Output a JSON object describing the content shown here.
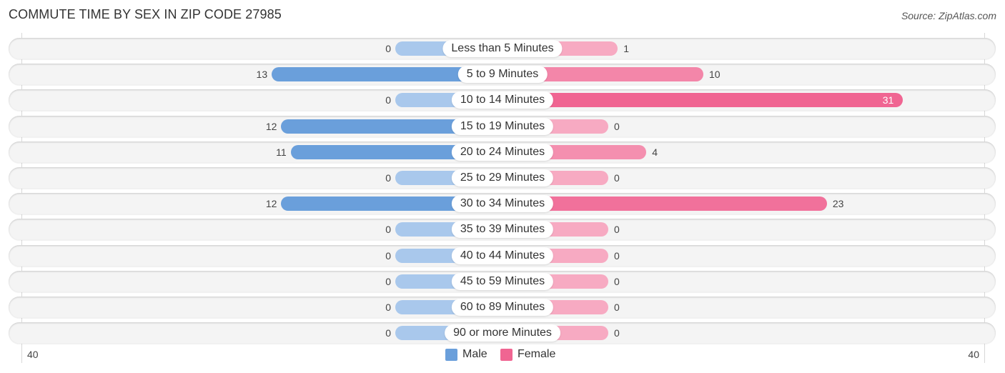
{
  "header": {
    "title": "COMMUTE TIME BY SEX IN ZIP CODE 27985",
    "source": "Source: ZipAtlas.com"
  },
  "colors": {
    "male": "#6a9fdb",
    "male_light": "#a9c8ec",
    "female": "#f06592",
    "female_light": "#f7aac2",
    "row_bg": "#f4f4f4"
  },
  "chart_data": {
    "type": "bar",
    "orientation": "horizontal-diverging",
    "title": "COMMUTE TIME BY SEX IN ZIP CODE 27985",
    "categories": [
      "Less than 5 Minutes",
      "5 to 9 Minutes",
      "10 to 14 Minutes",
      "15 to 19 Minutes",
      "20 to 24 Minutes",
      "25 to 29 Minutes",
      "30 to 34 Minutes",
      "35 to 39 Minutes",
      "40 to 44 Minutes",
      "45 to 59 Minutes",
      "60 to 89 Minutes",
      "90 or more Minutes"
    ],
    "series": [
      {
        "name": "Male",
        "values": [
          0,
          13,
          0,
          12,
          11,
          0,
          12,
          0,
          0,
          0,
          0,
          0
        ]
      },
      {
        "name": "Female",
        "values": [
          1,
          10,
          31,
          0,
          4,
          0,
          23,
          0,
          0,
          0,
          0,
          0
        ]
      }
    ],
    "xlim": [
      40,
      40
    ],
    "axis_tick_labels": {
      "left": "40",
      "right": "40"
    },
    "legend": {
      "position": "bottom-center",
      "entries": [
        "Male",
        "Female"
      ]
    },
    "grid": false
  },
  "legend": {
    "male_label": "Male",
    "female_label": "Female"
  },
  "axis": {
    "left_label": "40",
    "right_label": "40"
  }
}
